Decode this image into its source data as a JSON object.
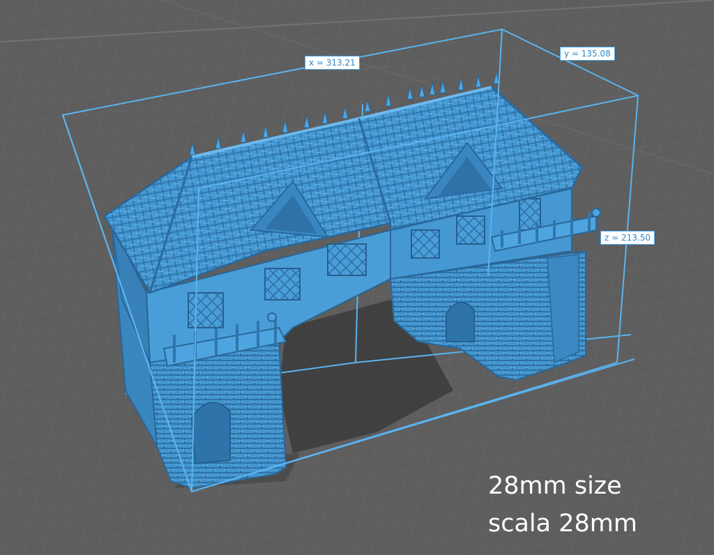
{
  "viewport": {
    "background_color": "#5e5e5e",
    "grid_line_color": "#6c6c6c",
    "model_color": "#4a9fd8",
    "bounding_box_color": "#5ab4f0"
  },
  "dimensions": {
    "x": "x = 313.21",
    "y": "y = 135.08",
    "z": "z = 213.50"
  },
  "caption": {
    "line1": "28mm size",
    "line2": "scala 28mm"
  }
}
